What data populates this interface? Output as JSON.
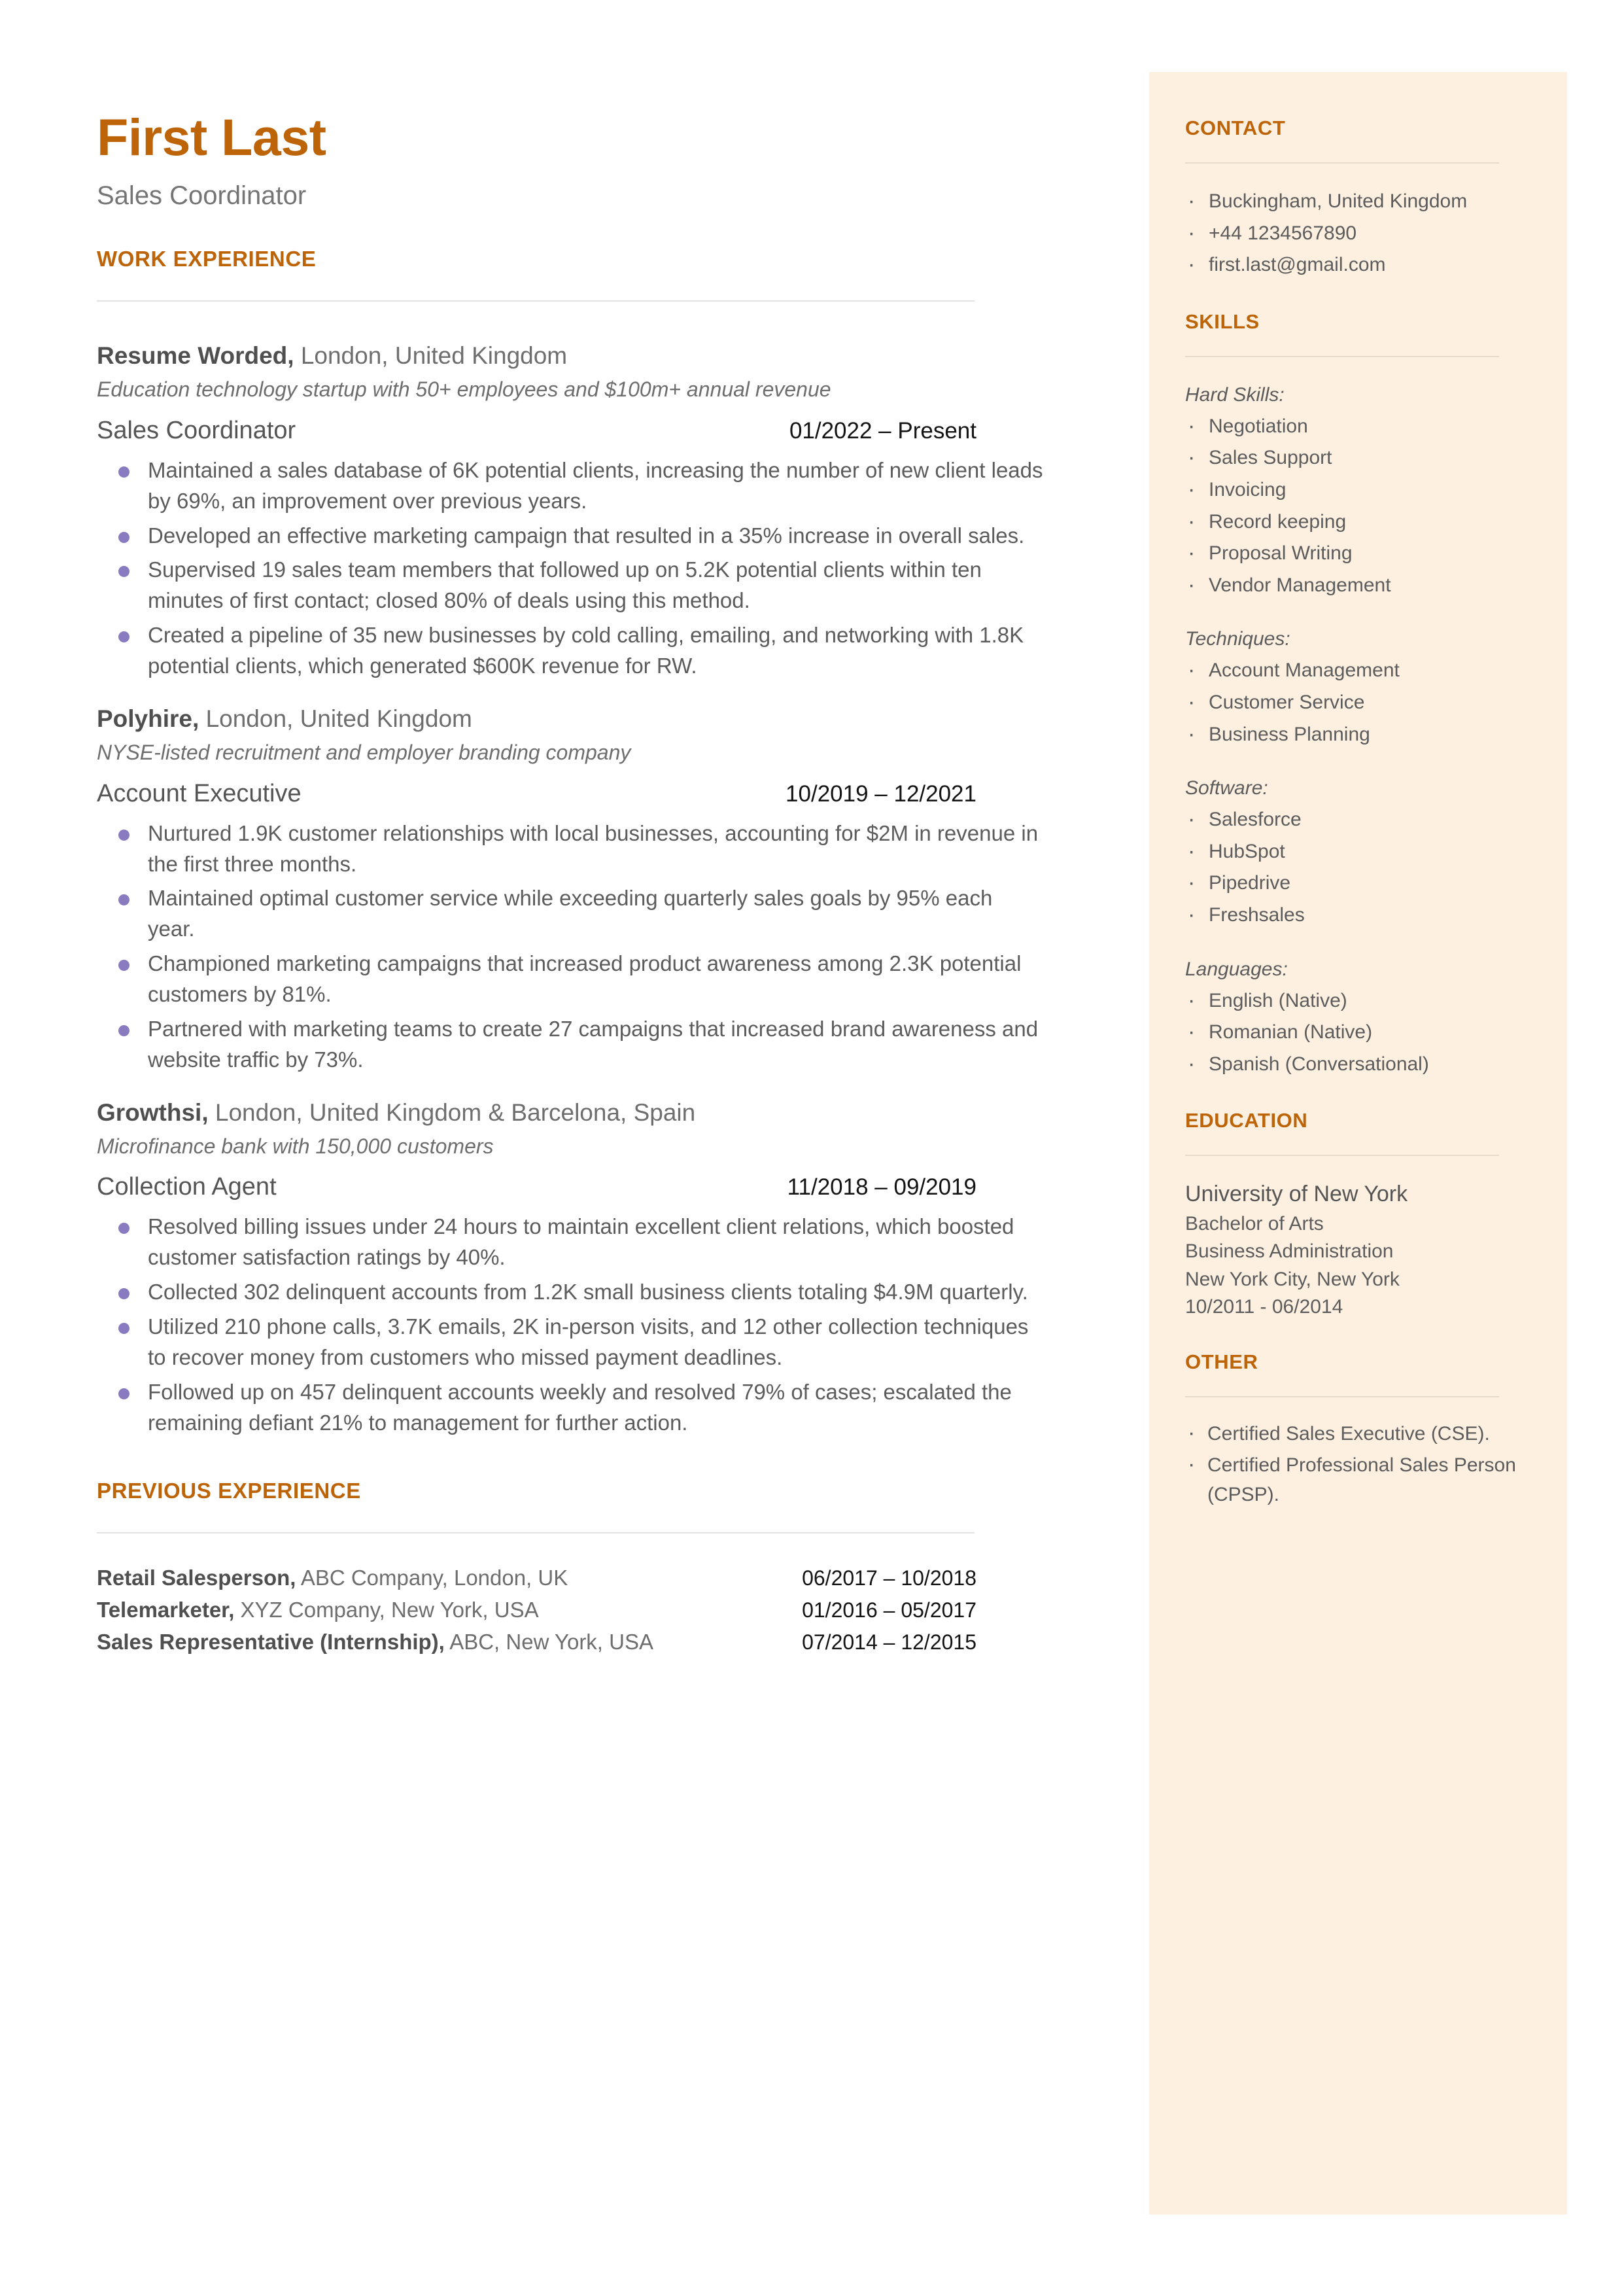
{
  "colors": {
    "accent": "#BD6409",
    "sidebar_bg": "#FDF0E0",
    "bullet": "#8A7ABF",
    "body_text": "#5C5C5C",
    "rule": "#E2E2E2"
  },
  "header": {
    "name": "First Last",
    "title": "Sales Coordinator"
  },
  "work_experience": {
    "heading": "WORK EXPERIENCE",
    "jobs": [
      {
        "company": "Resume Worded,",
        "location": "London, United Kingdom",
        "description": "Education technology startup with 50+ employees and $100m+ annual revenue",
        "role": "Sales Coordinator",
        "dates": "01/2022 – Present",
        "bullets": [
          "Maintained a sales database of 6K potential clients, increasing the number of new client leads by 69%, an improvement over previous years.",
          "Developed an effective marketing campaign that resulted in a 35% increase in overall sales.",
          "Supervised 19 sales team members that followed up on 5.2K potential clients within ten minutes of first contact; closed 80% of deals using this method.",
          "Created a pipeline of 35 new businesses by cold calling, emailing, and networking with 1.8K potential clients, which generated $600K revenue for RW."
        ]
      },
      {
        "company": "Polyhire,",
        "location": "London, United Kingdom",
        "description": "NYSE-listed recruitment and employer branding company",
        "role": "Account Executive",
        "dates": "10/2019 – 12/2021",
        "bullets": [
          "Nurtured 1.9K customer relationships with local businesses, accounting for $2M in revenue in the first three months.",
          "Maintained optimal customer service while exceeding quarterly sales goals by 95% each year.",
          "Championed marketing campaigns that increased product awareness among 2.3K potential customers by 81%.",
          "Partnered with marketing teams to create 27 campaigns that increased brand awareness and website traffic by 73%."
        ]
      },
      {
        "company": "Growthsi,",
        "location": "London, United Kingdom & Barcelona, Spain",
        "description": "Microfinance bank with 150,000 customers",
        "role": "Collection Agent",
        "dates": "11/2018 – 09/2019",
        "bullets": [
          "Resolved billing issues under 24 hours to maintain excellent client relations, which boosted customer satisfaction ratings by 40%.",
          "Collected 302 delinquent accounts from 1.2K small business clients totaling $4.9M quarterly.",
          "Utilized 210 phone calls, 3.7K emails, 2K in-person visits, and 12  other collection techniques to recover money from customers who missed payment deadlines.",
          "Followed up on 457 delinquent accounts weekly and resolved 79% of cases; escalated the remaining defiant 21% to management for further action."
        ]
      }
    ]
  },
  "previous_experience": {
    "heading": "PREVIOUS EXPERIENCE",
    "rows": [
      {
        "role": "Retail Salesperson,",
        "detail": "ABC Company, London, UK",
        "dates": "06/2017 – 10/2018"
      },
      {
        "role": "Telemarketer,",
        "detail": "XYZ Company, New York, USA",
        "dates": "01/2016 – 05/2017"
      },
      {
        "role": "Sales Representative (Internship),",
        "detail": "ABC, New York, USA",
        "dates": "07/2014 – 12/2015"
      }
    ]
  },
  "sidebar": {
    "contact": {
      "heading": "CONTACT",
      "items": [
        "Buckingham, United Kingdom",
        "+44 1234567890",
        "first.last@gmail.com"
      ]
    },
    "skills": {
      "heading": "SKILLS",
      "groups": [
        {
          "label": "Hard Skills:",
          "items": [
            "Negotiation",
            "Sales Support",
            "Invoicing",
            "Record keeping",
            "Proposal Writing",
            "Vendor Management"
          ]
        },
        {
          "label": "Techniques:",
          "items": [
            "Account Management",
            "Customer Service",
            "Business Planning"
          ]
        },
        {
          "label": "Software:",
          "items": [
            "Salesforce",
            "HubSpot",
            "Pipedrive",
            "Freshsales"
          ]
        },
        {
          "label": "Languages:",
          "items": [
            "English (Native)",
            "Romanian (Native)",
            "Spanish (Conversational)"
          ]
        }
      ]
    },
    "education": {
      "heading": "EDUCATION",
      "school": "University of New York",
      "degree": "Bachelor of Arts",
      "field": "Business Administration",
      "location": "New York City, New York",
      "dates": "10/2011 - 06/2014"
    },
    "other": {
      "heading": "OTHER",
      "items": [
        "Certified Sales Executive (CSE).",
        "Certified Professional Sales Person (CPSP)."
      ]
    }
  }
}
